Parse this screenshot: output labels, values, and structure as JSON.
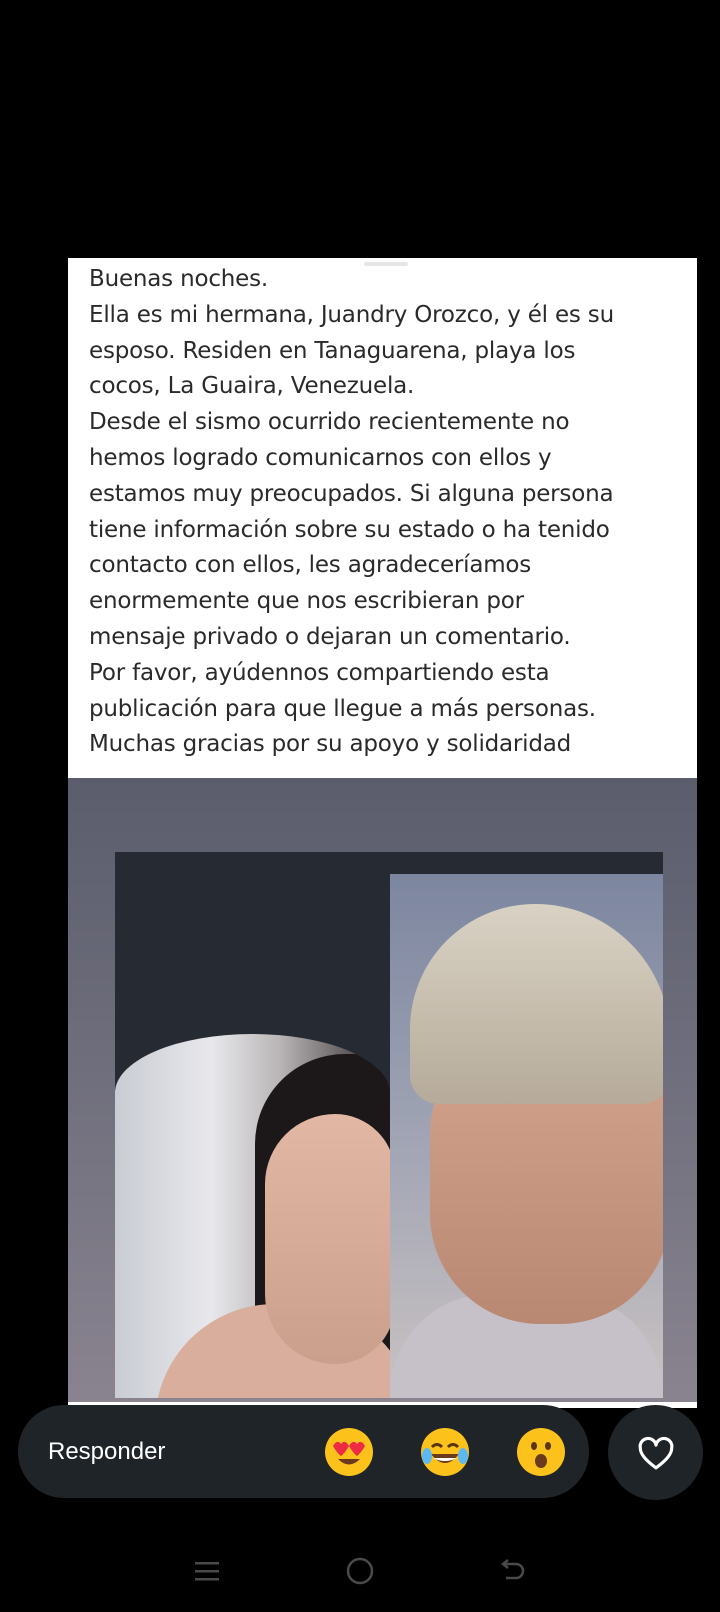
{
  "story": {
    "text_lines": [
      "Buenas noches.",
      "Ella es mi hermana, Juandry Orozco, y él es su",
      "esposo. Residen en Tanaguarena,  playa los",
      "cocos, La Guaira,  Venezuela.",
      "Desde el sismo ocurrido recientemente no",
      "hemos logrado comunicarnos con ellos y",
      "estamos muy preocupados. Si alguna persona",
      "tiene información sobre su estado o ha tenido",
      "contacto con ellos, les agradeceríamos",
      "enormemente que nos escribieran por",
      "mensaje privado o dejaran un comentario.",
      "Por favor, ayúdennos compartiendo esta",
      "publicación para que llegue a más personas.",
      "Muchas gracias por su apoyo y solidaridad"
    ]
  },
  "reply": {
    "placeholder": "Responder",
    "quick_reactions": [
      "heart-eyes-emoji",
      "tears-of-joy-emoji",
      "surprised-emoji"
    ]
  },
  "like_button": {
    "icon": "heart-outline-icon"
  },
  "nav": {
    "items": [
      "menu-icon",
      "home-icon",
      "back-icon"
    ]
  },
  "colors": {
    "background": "#000000",
    "reply_bar": "#1f2428",
    "text": "#2a2a2a"
  }
}
